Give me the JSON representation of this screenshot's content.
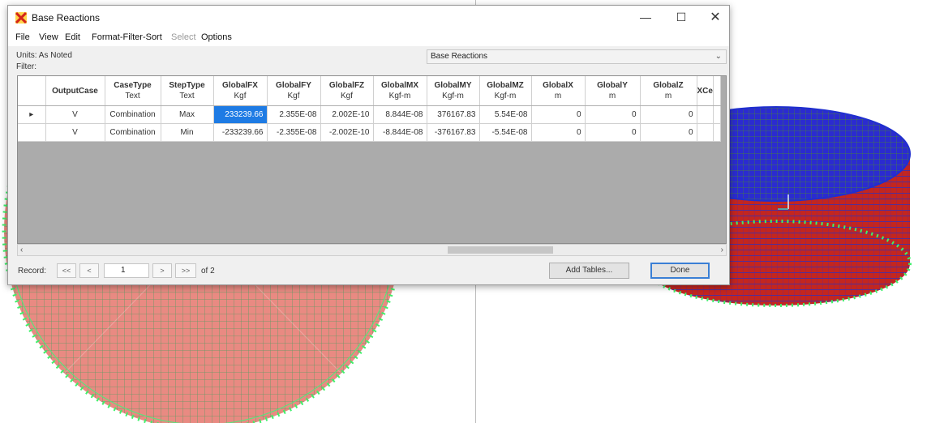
{
  "window": {
    "title": "Base Reactions",
    "minimize_icon": "minimize-icon",
    "maximize_icon": "maximize-icon",
    "close_icon": "close-icon"
  },
  "menu": [
    "File",
    "View",
    "Edit",
    "Format-Filter-Sort",
    "Select",
    "Options"
  ],
  "units_label": "Units: As Noted",
  "filter_label": "Filter:",
  "table_select": "Base Reactions",
  "table": {
    "columns": [
      {
        "name": "OutputCase",
        "unit": ""
      },
      {
        "name": "CaseType",
        "unit": "Text"
      },
      {
        "name": "StepType",
        "unit": "Text"
      },
      {
        "name": "GlobalFX",
        "unit": "Kgf"
      },
      {
        "name": "GlobalFY",
        "unit": "Kgf"
      },
      {
        "name": "GlobalFZ",
        "unit": "Kgf"
      },
      {
        "name": "GlobalMX",
        "unit": "Kgf-m"
      },
      {
        "name": "GlobalMY",
        "unit": "Kgf-m"
      },
      {
        "name": "GlobalMZ",
        "unit": "Kgf-m"
      },
      {
        "name": "GlobalX",
        "unit": "m"
      },
      {
        "name": "GlobalY",
        "unit": "m"
      },
      {
        "name": "GlobalZ",
        "unit": "m"
      },
      {
        "name": "XCe",
        "unit": ""
      }
    ],
    "rows": [
      [
        "V",
        "Combination",
        "Max",
        "233239.66",
        "2.355E-08",
        "2.002E-10",
        "8.844E-08",
        "376167.83",
        "5.54E-08",
        "0",
        "0",
        "0",
        ""
      ],
      [
        "V",
        "Combination",
        "Min",
        "-233239.66",
        "-2.355E-08",
        "-2.002E-10",
        "-8.844E-08",
        "-376167.83",
        "-5.54E-08",
        "0",
        "0",
        "0",
        ""
      ]
    ]
  },
  "navigation": {
    "label": "Record:",
    "first": "<<",
    "prev": "<",
    "current": "1",
    "next": ">",
    "last": ">>",
    "of_total": "of 2"
  },
  "buttons": {
    "add_tables": "Add Tables...",
    "done": "Done"
  },
  "colors": {
    "selection": "#1e7be4",
    "grid_empty": "#ababab",
    "model_red": "#d8322b",
    "model_blue": "#1428d8",
    "support_green": "#31e35a"
  }
}
